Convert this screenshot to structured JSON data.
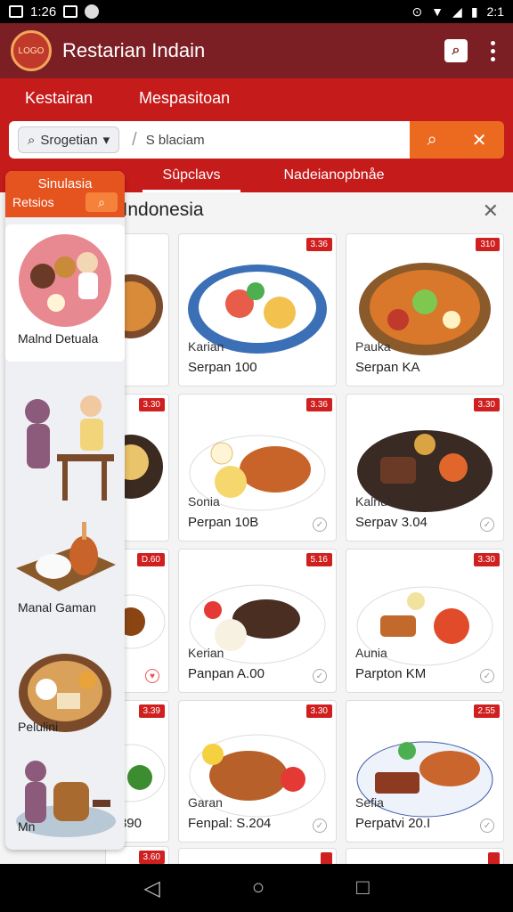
{
  "status_bar": {
    "time": "1:26",
    "right_time": "2:1"
  },
  "app_bar": {
    "title": "Restarian Indain",
    "logo_text": "LOGO"
  },
  "nav": {
    "items": [
      "Kestairan",
      "Mespasitoan"
    ]
  },
  "search": {
    "category": "Srogetian",
    "placeholder": "S blaciam"
  },
  "tabs": [
    "Sûpclavs",
    "Nadeianopbnåe"
  ],
  "section": {
    "title": "a Indonesia"
  },
  "side_panel": {
    "title": "Sinulasia",
    "subtitle": "Retsios",
    "items": [
      "Malnd Detuala",
      "",
      "Manal Gaman",
      "Pelulini",
      "Mn"
    ]
  },
  "cards": [
    {
      "price": "3.36",
      "name": "Karian",
      "serves": "Serpan 100",
      "check": false
    },
    {
      "price": "310",
      "name": "Pauka",
      "serves": "Serpan KA",
      "check": false
    },
    {
      "price": "3.36",
      "name": "Sonia",
      "serves": "Perpan 10B",
      "check": true
    },
    {
      "price": "3.30",
      "name": "Kalnu",
      "serves": "Serpav 3.04",
      "check": true
    },
    {
      "price": "5.16",
      "name": "Kerian",
      "serves": "Panpan A.00",
      "check": true
    },
    {
      "price": "3.30",
      "name": "Aunia",
      "serves": "Parpton KM",
      "check": true
    },
    {
      "price": "3.30",
      "name": "Garan",
      "serves": "Fenpal: S.204",
      "check": true
    },
    {
      "price": "2.55",
      "name": "Sefia",
      "serves": "Perpatvi 20.I",
      "check": true
    }
  ],
  "left_prices": [
    "3.30",
    "D.60",
    "3.39",
    "3.60"
  ],
  "left_bottom_text": "390",
  "colors": {
    "appbar": "#7b1f24",
    "header": "#c61b1b",
    "accent": "#ec6a1f"
  }
}
